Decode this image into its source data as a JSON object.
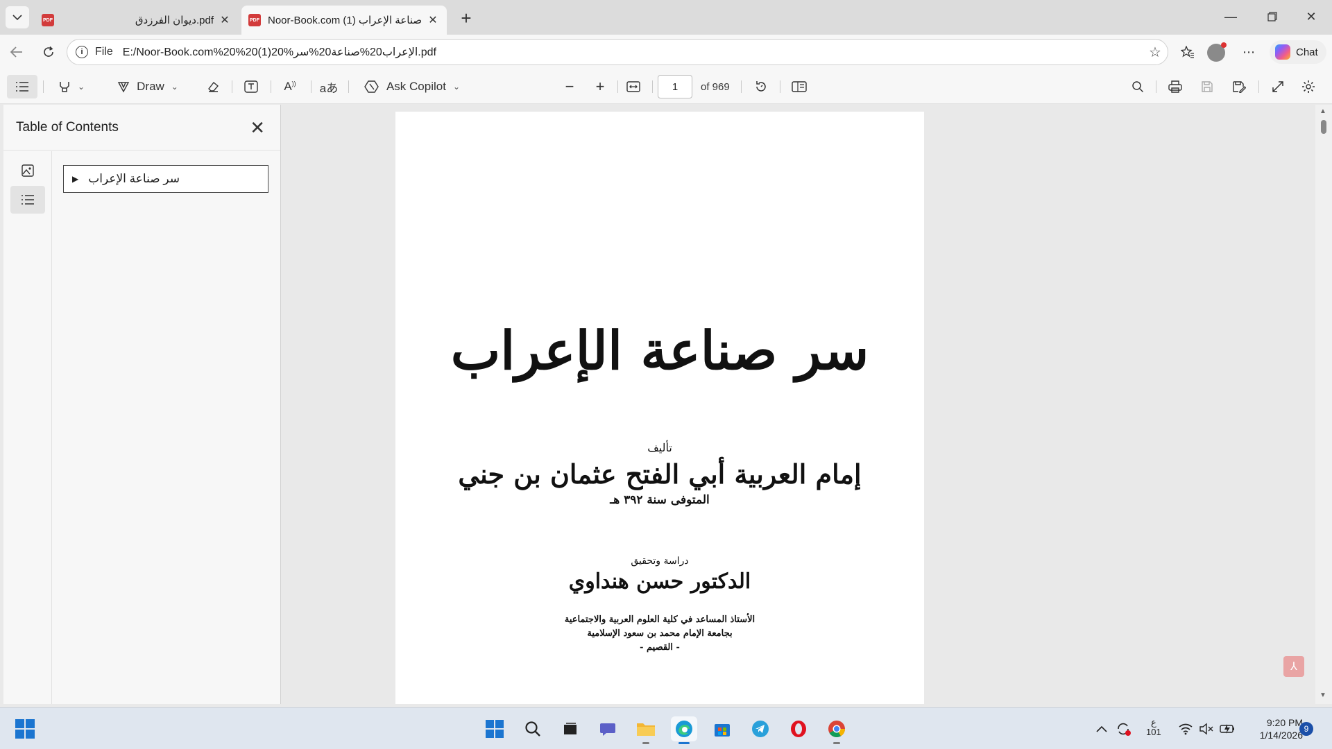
{
  "browser": {
    "tabs": [
      {
        "title": "ديوان الفرزدق.pdf",
        "icon": "pdf-icon",
        "active": false
      },
      {
        "title": "Noor-Book.com (1) صناعة الإعراب",
        "icon": "pdf-icon",
        "active": true
      }
    ],
    "address": {
      "scheme": "File",
      "url": "E:/Noor-Book.com%20%20(1)20%الإعراب20%صناعة20%سر.pdf"
    },
    "chat_label": "Chat"
  },
  "pdf_toolbar": {
    "draw_label": "Draw",
    "copilot_label": "Ask Copilot",
    "page_number": "1",
    "page_count": "of 969"
  },
  "sidebar": {
    "title": "Table of Contents",
    "items": [
      {
        "label": "سر صناعة الإعراب"
      }
    ]
  },
  "document": {
    "cover_title": "سر صناعة الإعراب",
    "by_label": "تأليف",
    "author": "إمام العربية أبي الفتح عثمان بن جني",
    "death": "المتوفى سنة ٣٩٢ هـ",
    "study_label": "دراسة وتحقيق",
    "editor": "الدكتور حسن هنداوي",
    "affiliation_1": "الأستاذ المساعد في كلية العلوم العربية والاجتماعية",
    "affiliation_2": "بجامعة الإمام محمد بن سعود الإسلامية",
    "affiliation_3": "- القصيم -"
  },
  "taskbar": {
    "tray_lang": "ع",
    "tray_temp": "101",
    "time": "9:20 PM",
    "date": "1/14/2026",
    "notification_count": "9"
  },
  "colors": {
    "accent": "#1b75d0",
    "pdf_red": "#d23b3b"
  }
}
